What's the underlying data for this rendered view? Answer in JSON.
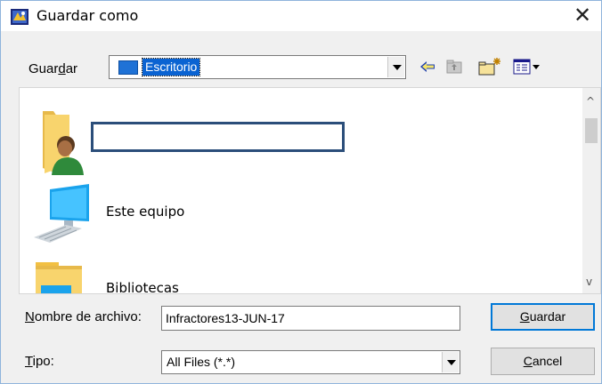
{
  "window": {
    "title": "Guardar como",
    "close_glyph": "✕"
  },
  "toolbar": {
    "save_in_label_pre": "Guar",
    "save_in_label_u": "d",
    "save_in_label_post": "ar",
    "location_value": "Escritorio",
    "icons": [
      "back-arrow-icon",
      "up-folder-icon",
      "new-folder-icon",
      "view-menu-icon"
    ]
  },
  "list": {
    "items": [
      {
        "label": "",
        "icon": "user-folder-icon"
      },
      {
        "label": "Este equipo",
        "icon": "computer-icon"
      },
      {
        "label": "Bibliotecas",
        "icon": "libraries-icon"
      }
    ]
  },
  "form": {
    "filename_label_u": "N",
    "filename_label_rest": "ombre de archivo:",
    "filename_value": "Infractores13-JUN-17",
    "type_label_u": "T",
    "type_label_rest": "ipo:",
    "type_value": "All Files (*.*)"
  },
  "buttons": {
    "save_u": "G",
    "save_rest": "uardar",
    "cancel_u": "C",
    "cancel_rest": "ancel"
  },
  "colors": {
    "accent": "#0078d7",
    "selection": "#0a63d2"
  }
}
